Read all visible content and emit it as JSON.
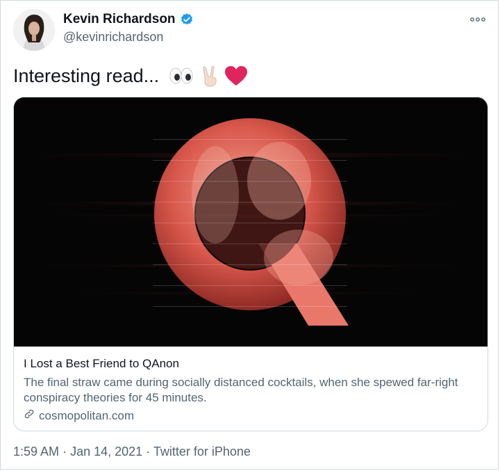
{
  "author": {
    "name": "Kevin Richardson",
    "handle": "@kevinrichardson",
    "verified": true
  },
  "tweet": {
    "text": "Interesting read...",
    "emojis": [
      "eyes-icon",
      "victory-hand-icon",
      "red-heart-icon"
    ]
  },
  "card": {
    "image_icon": "qanon-q-logo",
    "title": "I Lost a Best Friend to QAnon",
    "description": "The final straw came during socially distanced cocktails, when she spewed far-right conspiracy theories for 45 minutes.",
    "domain": "cosmopolitan.com"
  },
  "meta": {
    "time": "1:59 AM",
    "date": "Jan 14, 2021",
    "source": "Twitter for iPhone"
  },
  "colors": {
    "verified": "#1d9bf0",
    "heart": "#e0245e",
    "muted": "#536471",
    "border": "#cfd9de"
  }
}
